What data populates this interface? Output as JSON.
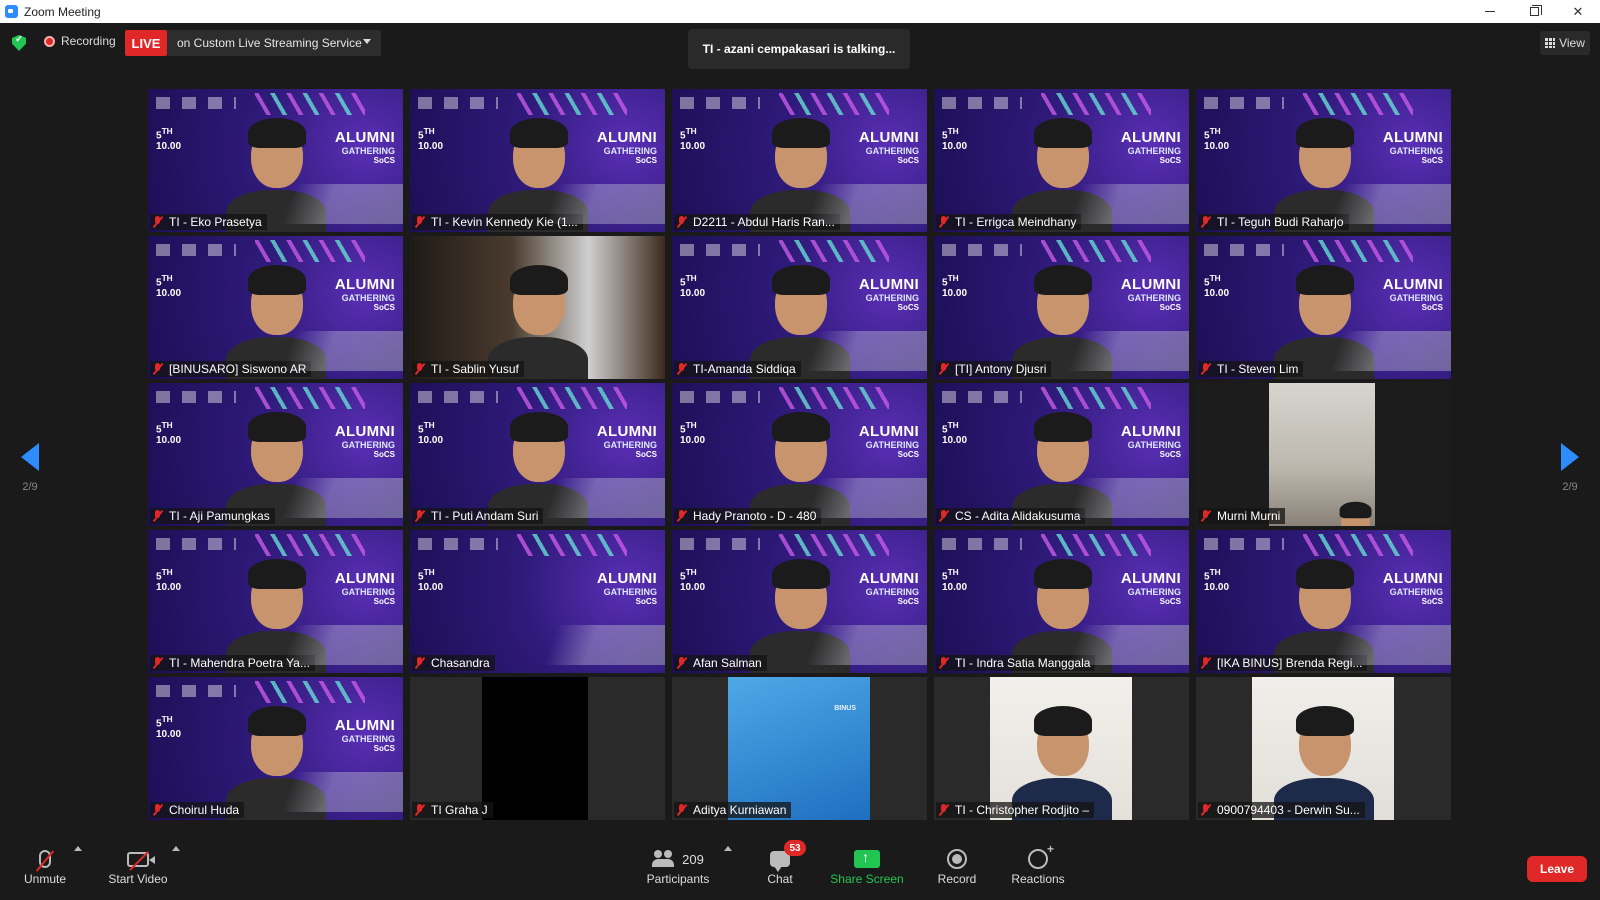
{
  "window": {
    "title": "Zoom Meeting",
    "controls": [
      "minimize",
      "restore",
      "close"
    ]
  },
  "top_bar": {
    "recording_label": "Recording",
    "live_label": "LIVE",
    "stream_label": "on Custom Live Streaming Service",
    "talking_text": "TI - azani cempakasari is talking...",
    "view_label": "View"
  },
  "pagination": {
    "left_label": "2/9",
    "right_label": "2/9"
  },
  "participants": [
    {
      "name": "TI - Eko Prasetya"
    },
    {
      "name": "TI - Kevin Kennedy Kie (1..."
    },
    {
      "name": "D2211 - Abdul Haris Ran..."
    },
    {
      "name": "TI - Errigca Meindhany"
    },
    {
      "name": "TI - Teguh Budi Raharjo"
    },
    {
      "name": "[BINUSARO] Siswono AR"
    },
    {
      "name": "TI - Sablin Yusuf"
    },
    {
      "name": "TI-Amanda Siddiqa"
    },
    {
      "name": "[TI] Antony Djusri"
    },
    {
      "name": "TI - Steven Lim"
    },
    {
      "name": "TI - Aji Pamungkas"
    },
    {
      "name": "TI - Puti Andam Suri"
    },
    {
      "name": "Hady Pranoto - D - 480"
    },
    {
      "name": "CS - Adita Alidakusuma"
    },
    {
      "name": "Murni Murni"
    },
    {
      "name": "TI - Mahendra Poetra Ya..."
    },
    {
      "name": "Chasandra"
    },
    {
      "name": "Afan Salman"
    },
    {
      "name": "TI - Indra Satia Manggala"
    },
    {
      "name": "[IKA BINUS] Brenda Regi..."
    },
    {
      "name": "Choirul Huda"
    },
    {
      "name": "TI Graha J"
    },
    {
      "name": "Aditya Kurniawan"
    },
    {
      "name": "TI - Christopher Rodjito –"
    },
    {
      "name": "0900794403 - Derwin Su..."
    }
  ],
  "banner": {
    "title": "ALUMNI",
    "subtitle": "GATHERING",
    "org": "SoCS",
    "day": "5",
    "day_suffix": "TH",
    "time": "10.00"
  },
  "toolbar": {
    "unmute_label": "Unmute",
    "start_video_label": "Start Video",
    "participants_count": "209",
    "participants_label": "Participants",
    "chat_label": "Chat",
    "chat_badge": "53",
    "share_label": "Share Screen",
    "record_label": "Record",
    "reactions_label": "Reactions",
    "leave_label": "Leave"
  },
  "colors": {
    "accent": "#2d8cff",
    "live_red": "#e02828",
    "share_green": "#23c552",
    "banner_purple": "#2f1a7a"
  }
}
